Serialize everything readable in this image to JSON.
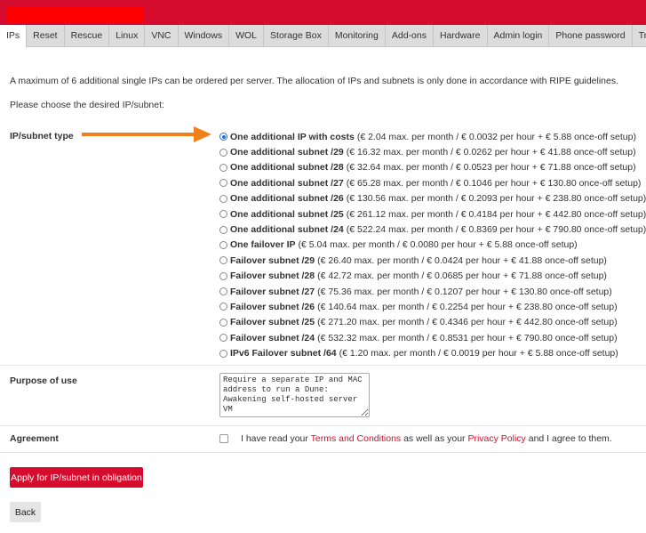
{
  "tabs": [
    "IPs",
    "Reset",
    "Rescue",
    "Linux",
    "VNC",
    "Windows",
    "WOL",
    "Storage Box",
    "Monitoring",
    "Add-ons",
    "Hardware",
    "Admin login",
    "Phone password",
    "Transf"
  ],
  "intro": "A maximum of 6 additional single IPs can be ordered per server. The allocation of IPs and subnets is only done in accordance with RIPE guidelines.",
  "choose": "Please choose the desired IP/subnet:",
  "ip_type_label": "IP/subnet type",
  "options": [
    {
      "name": "One additional IP with costs",
      "details": "(€ 2.04 max. per month / € 0.0032 per hour + € 5.88 once-off setup)",
      "selected": true
    },
    {
      "name": "One additional subnet /29",
      "details": "(€ 16.32 max. per month / € 0.0262 per hour + € 41.88 once-off setup)",
      "selected": false
    },
    {
      "name": "One additional subnet /28",
      "details": "(€ 32.64 max. per month / € 0.0523 per hour + € 71.88 once-off setup)",
      "selected": false
    },
    {
      "name": "One additional subnet /27",
      "details": "(€ 65.28 max. per month / € 0.1046 per hour + € 130.80 once-off setup)",
      "selected": false
    },
    {
      "name": "One additional subnet /26",
      "details": "(€ 130.56 max. per month / € 0.2093 per hour + € 238.80 once-off setup)",
      "selected": false
    },
    {
      "name": "One additional subnet /25",
      "details": "(€ 261.12 max. per month / € 0.4184 per hour + € 442.80 once-off setup)",
      "selected": false
    },
    {
      "name": "One additional subnet /24",
      "details": "(€ 522.24 max. per month / € 0.8369 per hour + € 790.80 once-off setup)",
      "selected": false
    },
    {
      "name": "One failover IP",
      "details": "(€ 5.04 max. per month / € 0.0080 per hour + € 5.88 once-off setup)",
      "selected": false
    },
    {
      "name": "Failover subnet /29",
      "details": "(€ 26.40 max. per month / € 0.0424 per hour + € 41.88 once-off setup)",
      "selected": false
    },
    {
      "name": "Failover subnet /28",
      "details": "(€ 42.72 max. per month / € 0.0685 per hour + € 71.88 once-off setup)",
      "selected": false
    },
    {
      "name": "Failover subnet /27",
      "details": "(€ 75.36 max. per month / € 0.1207 per hour + € 130.80 once-off setup)",
      "selected": false
    },
    {
      "name": "Failover subnet /26",
      "details": "(€ 140.64 max. per month / € 0.2254 per hour + € 238.80 once-off setup)",
      "selected": false
    },
    {
      "name": "Failover subnet /25",
      "details": "(€ 271.20 max. per month / € 0.4346 per hour + € 442.80 once-off setup)",
      "selected": false
    },
    {
      "name": "Failover subnet /24",
      "details": "(€ 532.32 max. per month / € 0.8531 per hour + € 790.80 once-off setup)",
      "selected": false
    },
    {
      "name": "IPv6 Failover subnet /64",
      "details": "(€ 1.20 max. per month / € 0.0019 per hour + € 5.88 once-off setup)",
      "selected": false
    }
  ],
  "purpose_label": "Purpose of use",
  "purpose_value": "Require a separate IP and MAC address to run a Dune: Awakening self-hosted server VM",
  "agreement_label": "Agreement",
  "agreement_text": {
    "pre": "I have read your ",
    "terms": "Terms and Conditions",
    "mid": " as well as your ",
    "privacy": "Privacy Policy",
    "post": " and I agree to them."
  },
  "apply_label": "Apply for IP/subnet in obligation",
  "back_label": "Back",
  "colors": {
    "brand": "#d50c2d",
    "arrow": "#f08119",
    "radio_selected": "#1a73e8"
  }
}
